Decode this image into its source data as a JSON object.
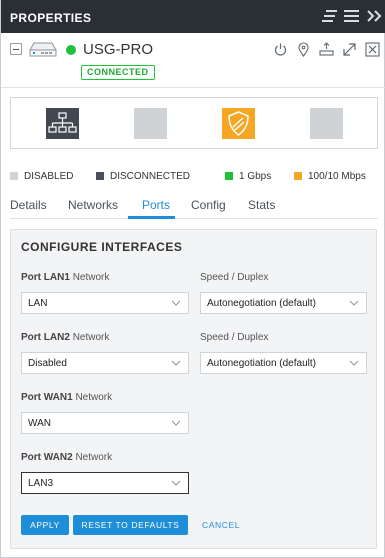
{
  "header": {
    "title": "PROPERTIES",
    "icons": [
      "list-filter-icon",
      "menu-icon",
      "double-chevron-right-icon"
    ]
  },
  "device": {
    "name": "USG-PRO",
    "status": "CONNECTED",
    "status_color": "#1fc239",
    "actions": [
      "power-icon",
      "locate-icon",
      "upgrade-icon",
      "expand-icon",
      "close-icon"
    ]
  },
  "legend": [
    {
      "label": "DISABLED",
      "color": "#cfd3d6"
    },
    {
      "label": "DISCONNECTED",
      "color": "#4a5058"
    },
    {
      "label": "1 Gbps",
      "color": "#1fc239"
    },
    {
      "label": "100/10 Mbps",
      "color": "#f5a623"
    }
  ],
  "tabs": [
    "Details",
    "Networks",
    "Ports",
    "Config",
    "Stats"
  ],
  "active_tab": "Ports",
  "configure": {
    "title": "CONFIGURE INTERFACES",
    "speed_label": "Speed / Duplex",
    "ports": [
      {
        "port": "Port LAN1",
        "suffix": "Network",
        "value": "LAN",
        "speed": "Autonegotiation (default)"
      },
      {
        "port": "Port LAN2",
        "suffix": "Network",
        "value": "Disabled",
        "speed": "Autonegotiation (default)"
      },
      {
        "port": "Port WAN1",
        "suffix": "Network",
        "value": "WAN"
      },
      {
        "port": "Port WAN2",
        "suffix": "Network",
        "value": "LAN3"
      }
    ],
    "apply_label": "APPLY",
    "reset_label": "RESET TO DEFAULTS",
    "cancel_label": "CANCEL"
  },
  "colors": {
    "accent": "#1e8ed8",
    "header_bg": "#2a2f35"
  }
}
